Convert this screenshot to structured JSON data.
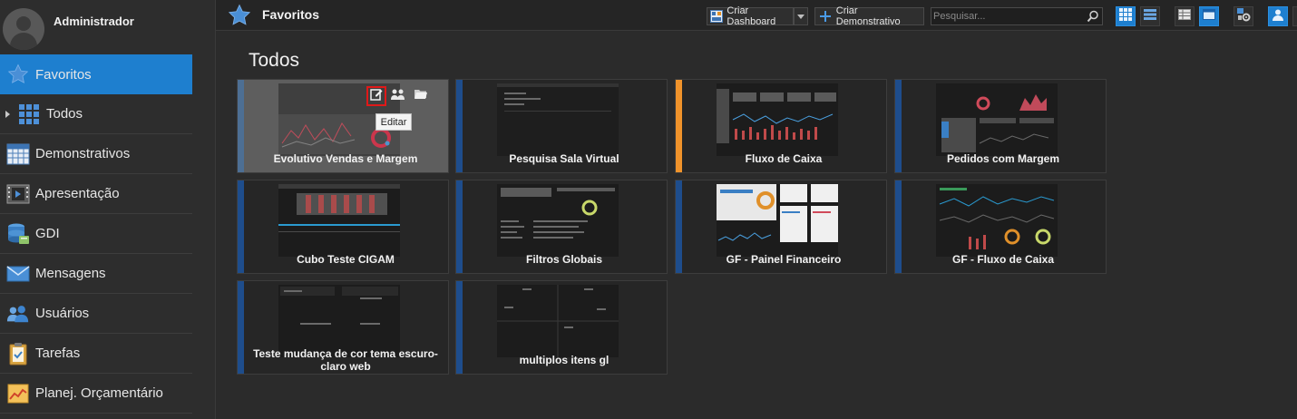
{
  "user": {
    "name": "Administrador"
  },
  "sidebar": {
    "items": [
      {
        "label": "Favoritos",
        "icon": "star-icon",
        "active": true
      },
      {
        "label": "Todos",
        "icon": "grid-icon",
        "active": false
      },
      {
        "label": "Demonstrativos",
        "icon": "spreadsheet-icon",
        "active": false
      },
      {
        "label": "Apresentação",
        "icon": "film-icon",
        "active": false
      },
      {
        "label": "GDI",
        "icon": "database-icon",
        "active": false
      },
      {
        "label": "Mensagens",
        "icon": "envelope-icon",
        "active": false
      },
      {
        "label": "Usuários",
        "icon": "users-icon",
        "active": false
      },
      {
        "label": "Tarefas",
        "icon": "clipboard-icon",
        "active": false
      },
      {
        "label": "Planej. Orçamentário",
        "icon": "chart-icon",
        "active": false
      }
    ]
  },
  "header": {
    "title": "Favoritos",
    "create_dashboard_label": "Criar Dashboard",
    "create_report_label": "Criar Demonstrativo",
    "search_placeholder": "Pesquisar..."
  },
  "main": {
    "section_title": "Todos",
    "tooltip": "Editar",
    "cards": [
      {
        "title": "Evolutivo Vendas e Margem",
        "accent": "#1e4d8c"
      },
      {
        "title": "Pesquisa Sala Virtual",
        "accent": "#1e4d8c"
      },
      {
        "title": "Fluxo de Caixa",
        "accent": "#f0932b"
      },
      {
        "title": "Pedidos com Margem",
        "accent": "#1e4d8c"
      },
      {
        "title": "Cubo Teste CIGAM",
        "accent": "#1e4d8c"
      },
      {
        "title": "Filtros Globais",
        "accent": "#1e4d8c"
      },
      {
        "title": "GF - Painel Financeiro",
        "accent": "#1e4d8c"
      },
      {
        "title": "GF - Fluxo de Caixa",
        "accent": "#1e4d8c"
      },
      {
        "title": "Teste mudança de cor tema escuro-claro web",
        "accent": "#1e4d8c"
      },
      {
        "title": "multiplos itens gl",
        "accent": "#1e4d8c"
      }
    ]
  },
  "colors": {
    "accent": "#1e7fcf",
    "highlight": "#e01818",
    "orange": "#f0932b"
  }
}
